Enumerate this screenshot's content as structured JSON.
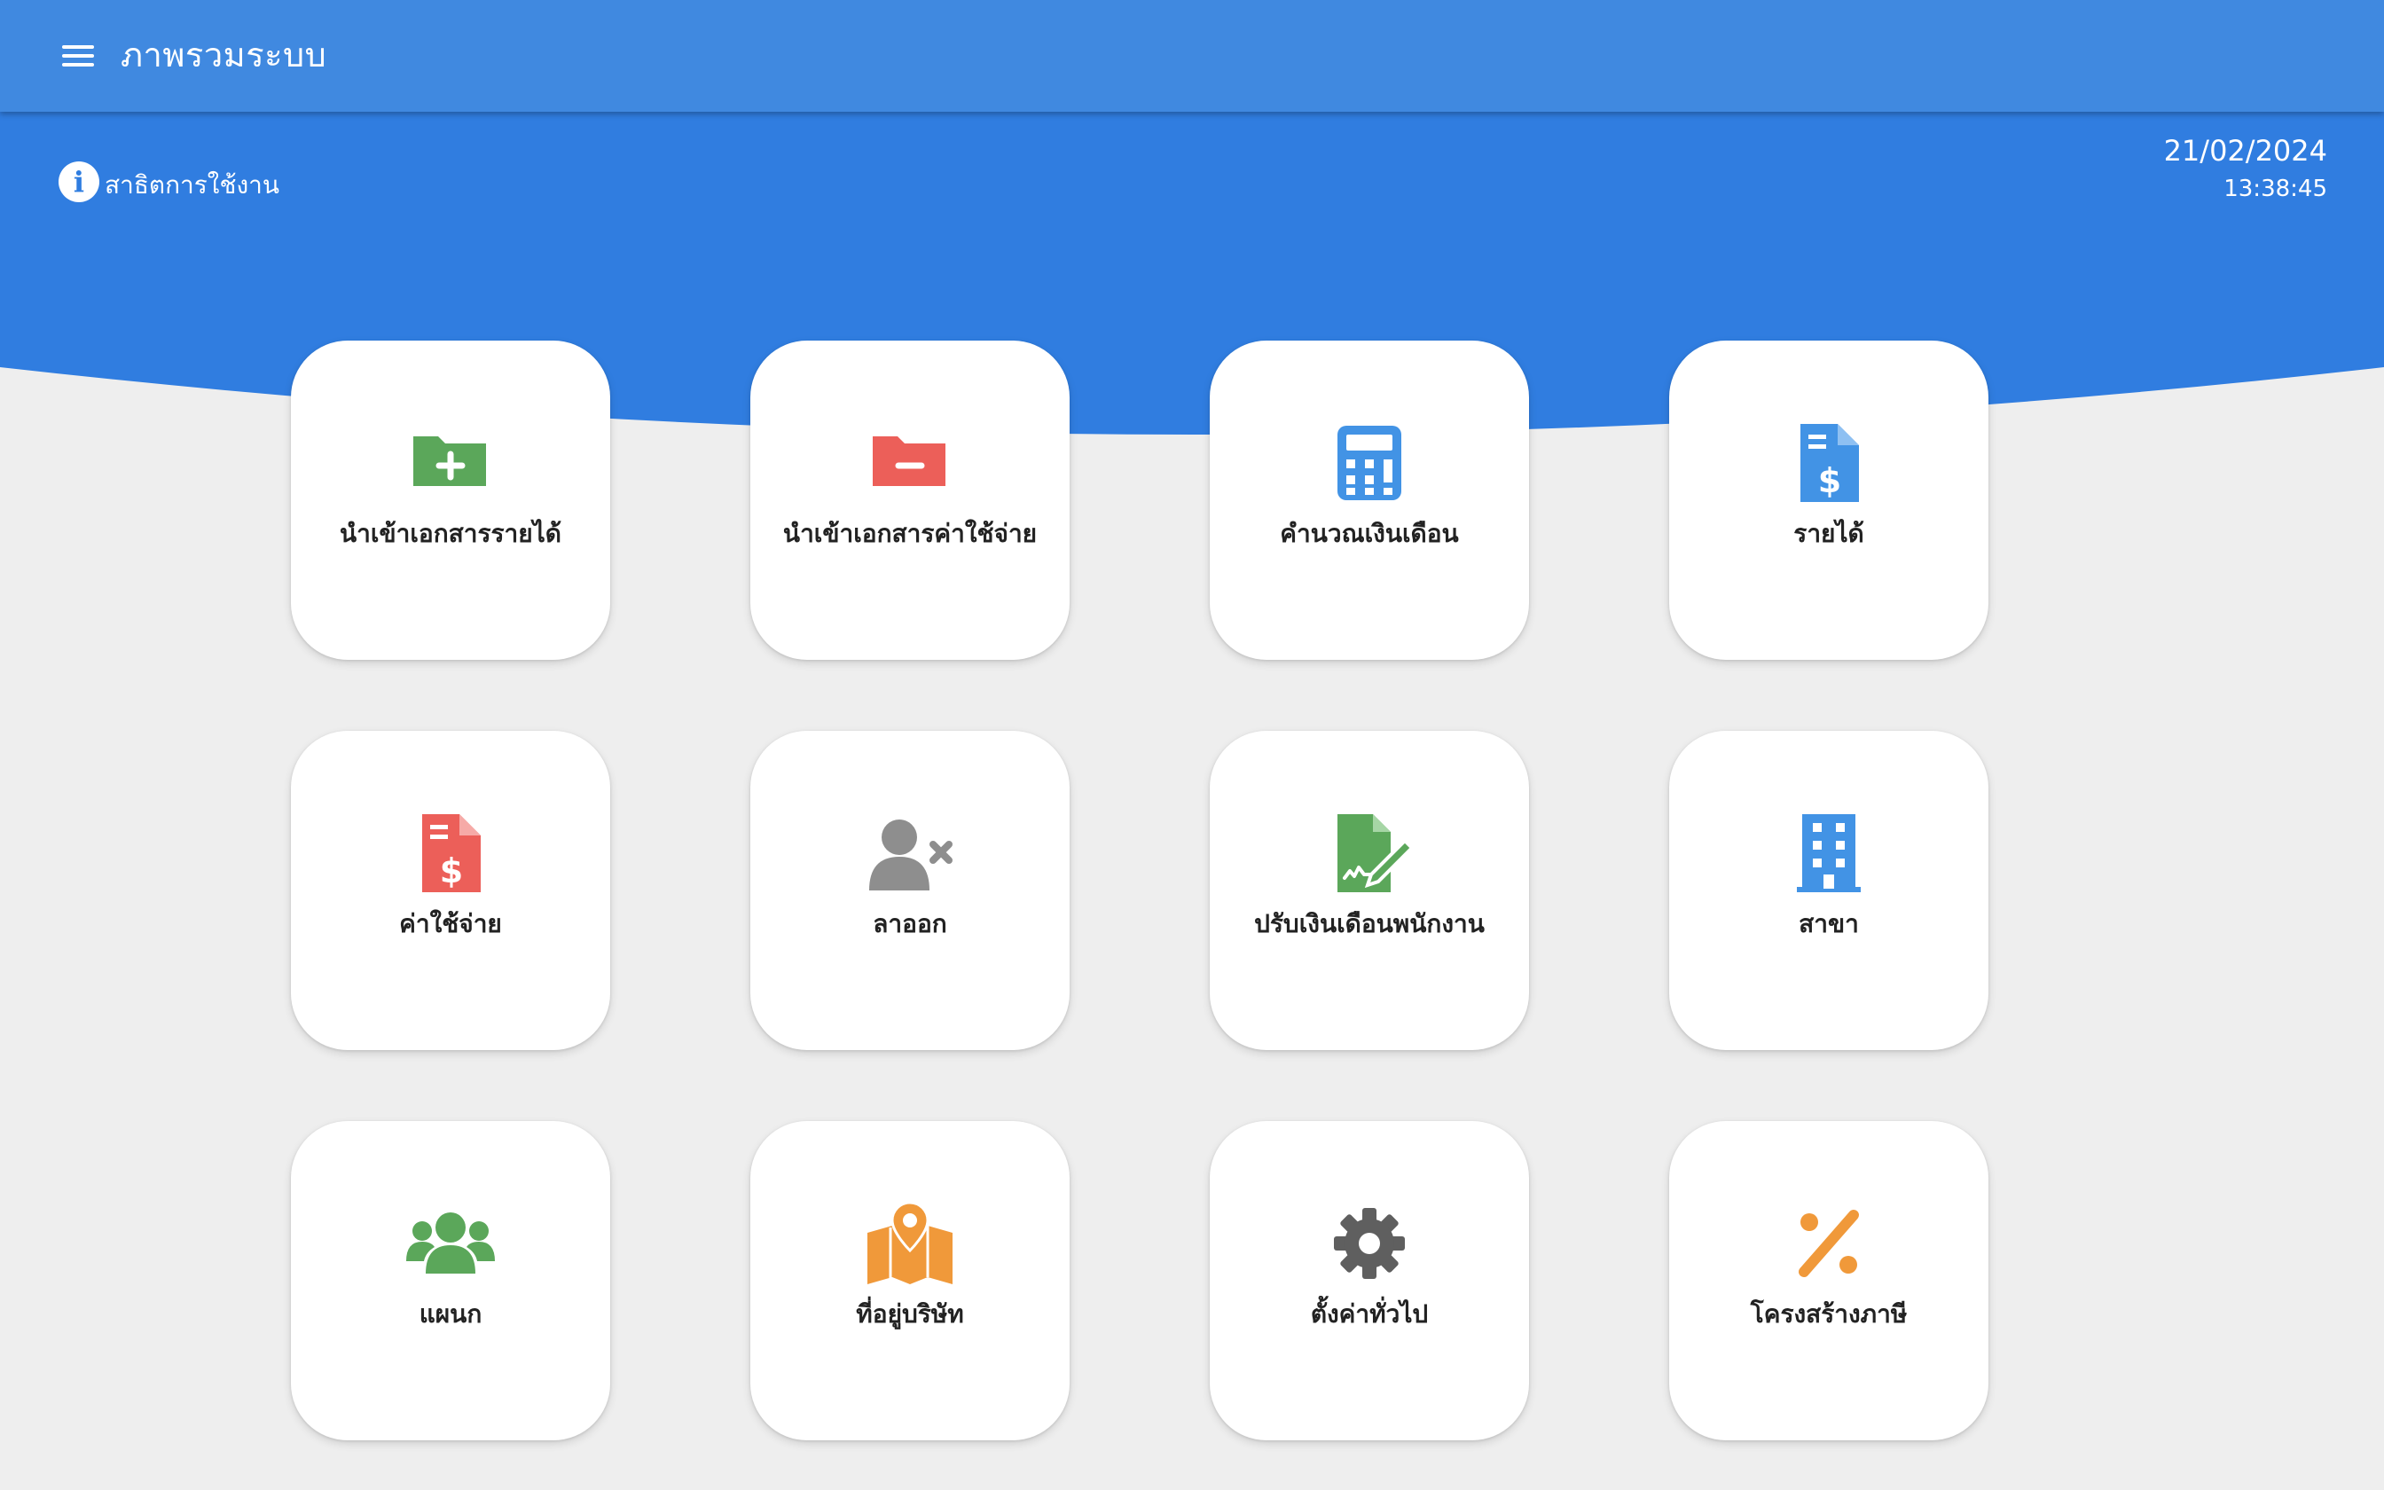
{
  "header": {
    "menu_icon": "hamburger-menu-icon",
    "title": "ภาพรวมระบบ"
  },
  "info": {
    "icon": "info-circle-icon",
    "label": "สาธิตการใช้งาน"
  },
  "datetime": {
    "date": "21/02/2024",
    "time": "13:38:45"
  },
  "colors": {
    "header": "#4089e0",
    "hero": "#307de0",
    "background": "#eeeeee",
    "green": "#5ba75a",
    "red": "#ec5f59",
    "blue": "#4293e5",
    "gray": "#8e8e8e",
    "dark_gray": "#5f5f5f",
    "orange": "#f0993a"
  },
  "cards": [
    {
      "label": "นำเข้าเอกสารรายได้",
      "icon": "folder-plus-icon"
    },
    {
      "label": "นำเข้าเอกสารค่าใช้จ่าย",
      "icon": "folder-minus-icon"
    },
    {
      "label": "คำนวณเงินเดือน",
      "icon": "calculator-icon"
    },
    {
      "label": "รายได้",
      "icon": "invoice-dollar-icon"
    },
    {
      "label": "ค่าใช้จ่าย",
      "icon": "invoice-dollar-icon"
    },
    {
      "label": "ลาออก",
      "icon": "user-remove-icon"
    },
    {
      "label": "ปรับเงินเดือนพนักงาน",
      "icon": "file-signature-icon"
    },
    {
      "label": "สาขา",
      "icon": "building-icon"
    },
    {
      "label": "แผนก",
      "icon": "users-group-icon"
    },
    {
      "label": "ที่อยู่บริษัท",
      "icon": "map-location-icon"
    },
    {
      "label": "ตั้งค่าทั่วไป",
      "icon": "gear-icon"
    },
    {
      "label": "โครงสร้างภาษี",
      "icon": "percent-icon"
    }
  ]
}
